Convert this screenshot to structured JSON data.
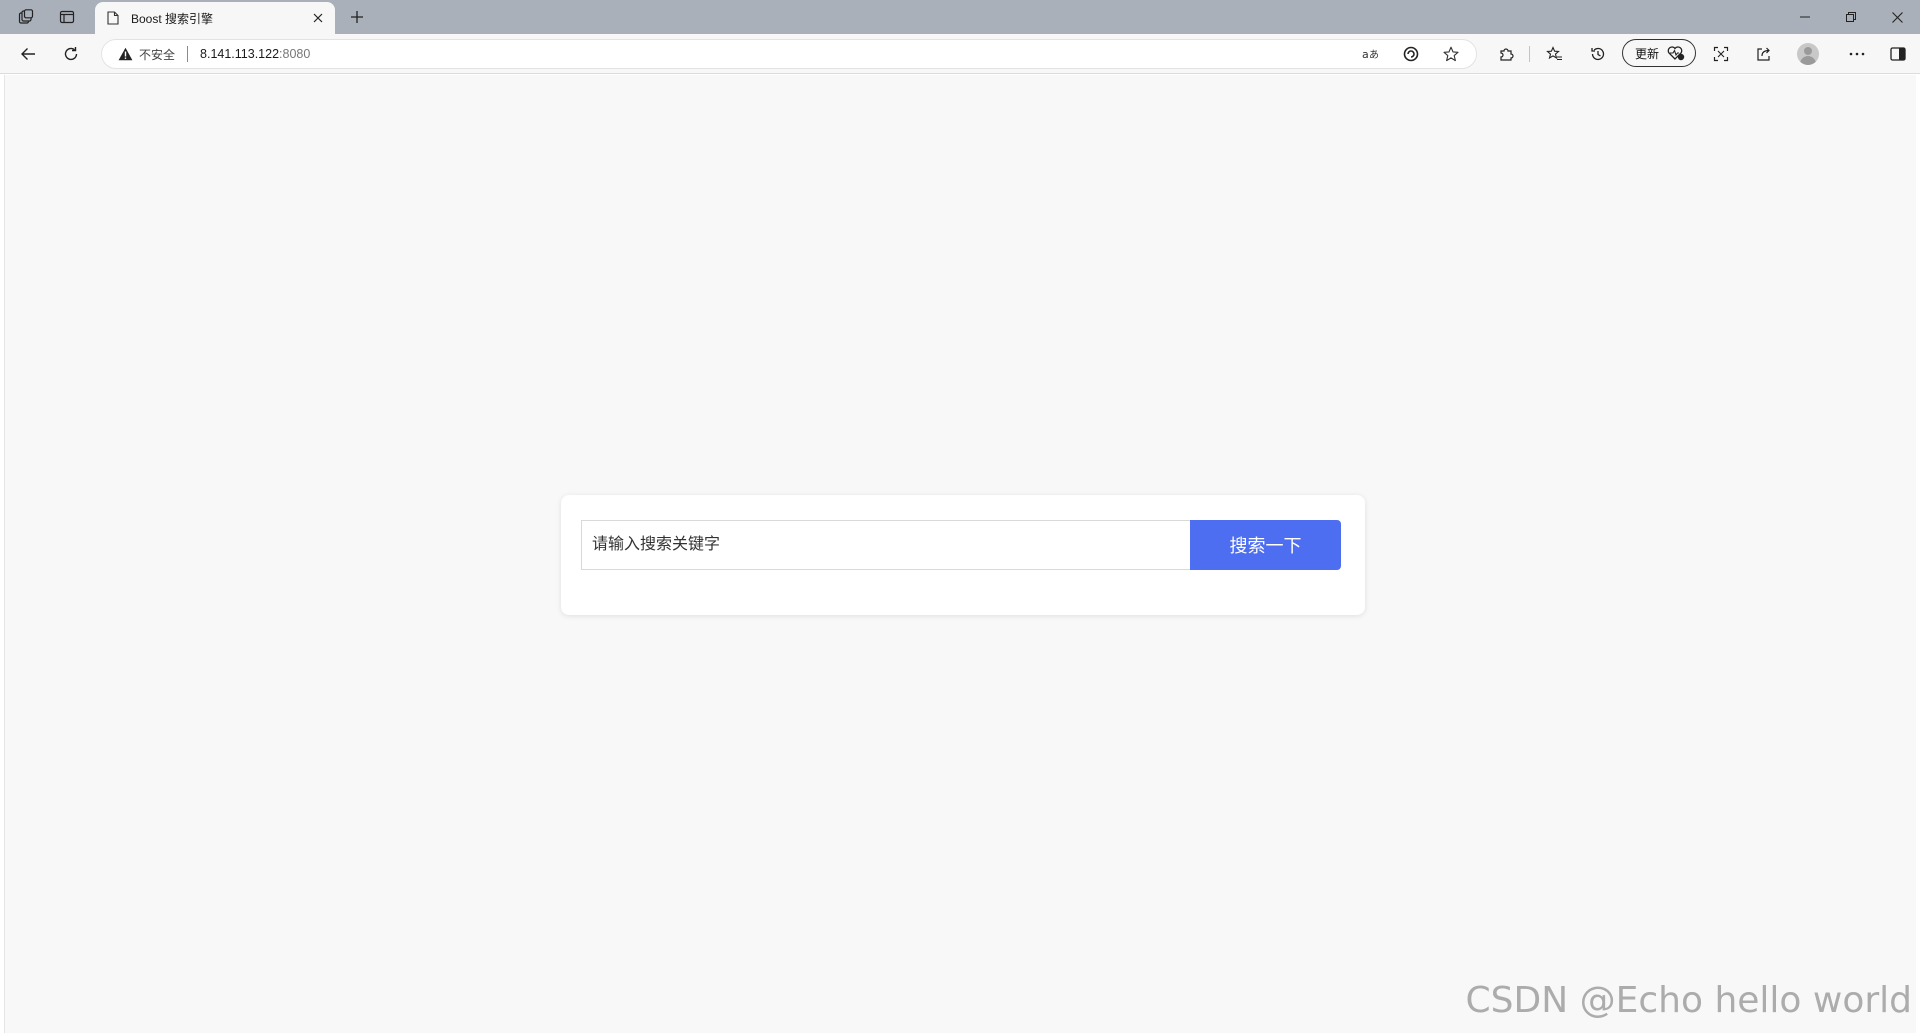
{
  "browser": {
    "tab": {
      "title": "Boost 搜索引擎",
      "favicon": "page-icon"
    },
    "address_bar": {
      "security_label": "不安全",
      "url_host": "8.141.113.122",
      "url_port": ":8080"
    },
    "toolbar": {
      "update_label": "更新"
    },
    "icons": {
      "workspaces": "workspaces-icon",
      "tab_actions": "tab-actions-icon",
      "back": "back-arrow-icon",
      "refresh": "refresh-icon",
      "warning": "warning-triangle-icon",
      "read_aloud": "read-aloud-icon",
      "translate": "translate-icon",
      "favorite": "star-icon",
      "extensions": "puzzle-icon",
      "favorites": "favorites-icon",
      "history": "history-icon",
      "screenshot": "screenshot-icon",
      "share": "share-icon",
      "more": "more-icon",
      "sidebar": "sidebar-icon"
    },
    "colors": {
      "tabstrip": "#a9b0ba",
      "toolbar": "#f7f7f7",
      "page_bg": "#f8f8f8"
    }
  },
  "page": {
    "search": {
      "placeholder": "请输入搜索关键字",
      "button_label": "搜索一下"
    },
    "colors": {
      "button": "#4e6ef2",
      "button_text": "#ffffff",
      "card": "#ffffff"
    }
  },
  "watermark": {
    "text": "CSDN @Echo hello world"
  }
}
